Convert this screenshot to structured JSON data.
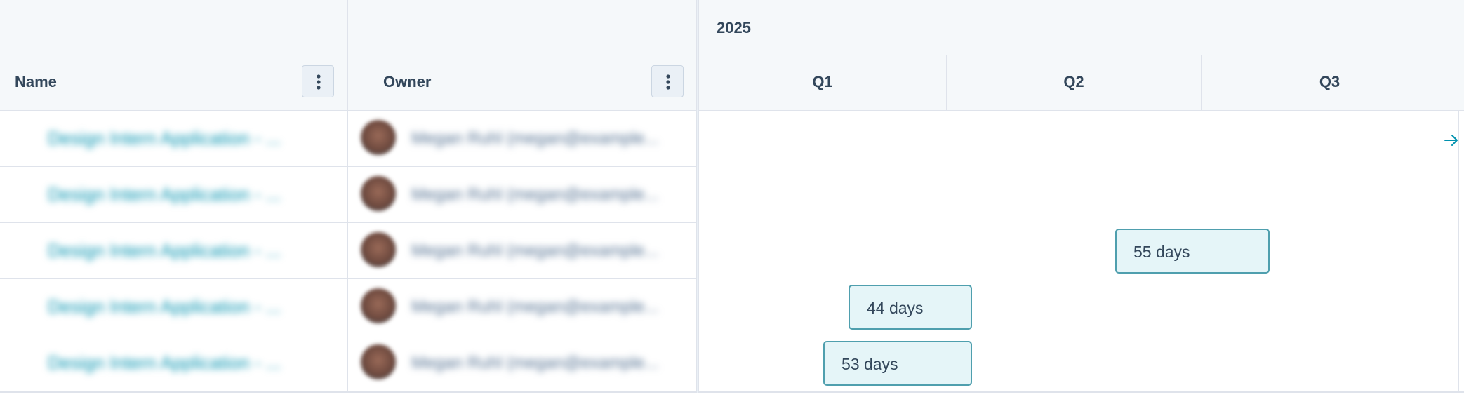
{
  "columns": {
    "name": {
      "label": "Name"
    },
    "owner": {
      "label": "Owner"
    }
  },
  "timeline": {
    "year": "2025",
    "quarters": [
      "Q1",
      "Q2",
      "Q3"
    ]
  },
  "rows": [
    {
      "name": "Design Intern Application - ...",
      "owner": "Megan Ruhl (megan@example..."
    },
    {
      "name": "Design Intern Application - ...",
      "owner": "Megan Ruhl (megan@example..."
    },
    {
      "name": "Design Intern Application - ...",
      "owner": "Megan Ruhl (megan@example..."
    },
    {
      "name": "Design Intern Application - ...",
      "owner": "Megan Ruhl (megan@example..."
    },
    {
      "name": "Design Intern Application - ...",
      "owner": "Megan Ruhl (megan@example..."
    }
  ],
  "bars": [
    {
      "row": 3,
      "label": "55 days"
    },
    {
      "row": 4,
      "label": "44 days"
    },
    {
      "row": 5,
      "label": "53 days"
    }
  ],
  "icons": {
    "column_menu": "vertical-dots-icon",
    "scroll_right": "arrow-right-icon"
  },
  "colors": {
    "link": "#0091ae",
    "bar_fill": "#e5f5f8",
    "bar_border": "#4f9fae",
    "header_bg": "#f5f8fa"
  }
}
